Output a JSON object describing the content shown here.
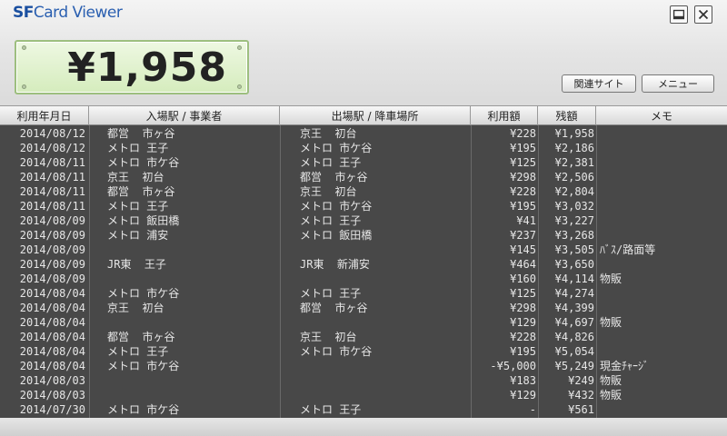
{
  "app": {
    "title_sf": "SF",
    "title_rest": "Card Viewer"
  },
  "balance": "¥1,958",
  "buttons": {
    "related_sites": "関連サイト",
    "menu": "メニュー"
  },
  "table": {
    "headers": [
      "利用年月日",
      "入場駅 / 事業者",
      "出場駅 / 降車場所",
      "利用額",
      "残額",
      "メモ"
    ],
    "rows": [
      {
        "date": "2014/08/12",
        "in": "都営  市ヶ谷",
        "out": "京王  初台",
        "amount": "¥228",
        "balance": "¥1,958",
        "memo": ""
      },
      {
        "date": "2014/08/12",
        "in": "メトロ 王子",
        "out": "メトロ 市ケ谷",
        "amount": "¥195",
        "balance": "¥2,186",
        "memo": ""
      },
      {
        "date": "2014/08/11",
        "in": "メトロ 市ケ谷",
        "out": "メトロ 王子",
        "amount": "¥125",
        "balance": "¥2,381",
        "memo": ""
      },
      {
        "date": "2014/08/11",
        "in": "京王  初台",
        "out": "都営  市ヶ谷",
        "amount": "¥298",
        "balance": "¥2,506",
        "memo": ""
      },
      {
        "date": "2014/08/11",
        "in": "都営  市ヶ谷",
        "out": "京王  初台",
        "amount": "¥228",
        "balance": "¥2,804",
        "memo": ""
      },
      {
        "date": "2014/08/11",
        "in": "メトロ 王子",
        "out": "メトロ 市ケ谷",
        "amount": "¥195",
        "balance": "¥3,032",
        "memo": ""
      },
      {
        "date": "2014/08/09",
        "in": "メトロ 飯田橋",
        "out": "メトロ 王子",
        "amount": "¥41",
        "balance": "¥3,227",
        "memo": ""
      },
      {
        "date": "2014/08/09",
        "in": "メトロ 浦安",
        "out": "メトロ 飯田橋",
        "amount": "¥237",
        "balance": "¥3,268",
        "memo": ""
      },
      {
        "date": "2014/08/09",
        "in": "",
        "out": "",
        "amount": "¥145",
        "balance": "¥3,505",
        "memo": "ﾊﾞｽ/路面等"
      },
      {
        "date": "2014/08/09",
        "in": "JR東  王子",
        "out": "JR東  新浦安",
        "amount": "¥464",
        "balance": "¥3,650",
        "memo": ""
      },
      {
        "date": "2014/08/09",
        "in": "",
        "out": "",
        "amount": "¥160",
        "balance": "¥4,114",
        "memo": "物販"
      },
      {
        "date": "2014/08/04",
        "in": "メトロ 市ケ谷",
        "out": "メトロ 王子",
        "amount": "¥125",
        "balance": "¥4,274",
        "memo": ""
      },
      {
        "date": "2014/08/04",
        "in": "京王  初台",
        "out": "都営  市ヶ谷",
        "amount": "¥298",
        "balance": "¥4,399",
        "memo": ""
      },
      {
        "date": "2014/08/04",
        "in": "",
        "out": "",
        "amount": "¥129",
        "balance": "¥4,697",
        "memo": "物販"
      },
      {
        "date": "2014/08/04",
        "in": "都営  市ヶ谷",
        "out": "京王  初台",
        "amount": "¥228",
        "balance": "¥4,826",
        "memo": ""
      },
      {
        "date": "2014/08/04",
        "in": "メトロ 王子",
        "out": "メトロ 市ケ谷",
        "amount": "¥195",
        "balance": "¥5,054",
        "memo": ""
      },
      {
        "date": "2014/08/04",
        "in": "メトロ 市ケ谷",
        "out": "",
        "amount": "-¥5,000",
        "balance": "¥5,249",
        "memo": "現金ﾁｬｰｼﾞ"
      },
      {
        "date": "2014/08/03",
        "in": "",
        "out": "",
        "amount": "¥183",
        "balance": "¥249",
        "memo": "物販"
      },
      {
        "date": "2014/08/03",
        "in": "",
        "out": "",
        "amount": "¥129",
        "balance": "¥432",
        "memo": "物販"
      },
      {
        "date": "2014/07/30",
        "in": "メトロ 市ケ谷",
        "out": "メトロ 王子",
        "amount": "-",
        "balance": "¥561",
        "memo": ""
      }
    ]
  }
}
